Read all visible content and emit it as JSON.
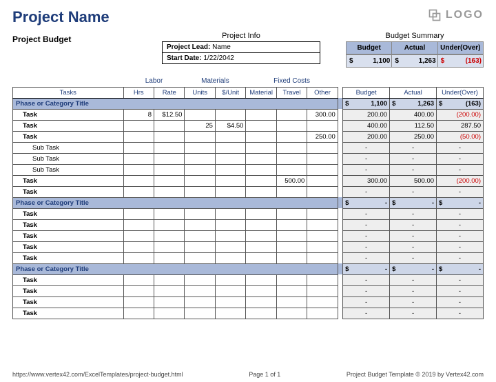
{
  "title": "Project Name",
  "subtitle": "Project Budget",
  "logo_text": "LOGO",
  "project_info": {
    "heading": "Project Info",
    "lead_label": "Project Lead:",
    "lead_value": "Name",
    "date_label": "Start Date:",
    "date_value": "1/22/2042"
  },
  "budget_summary": {
    "heading": "Budget Summary",
    "cols": [
      "Budget",
      "Actual",
      "Under(Over)"
    ],
    "vals": [
      "1,100",
      "1,263",
      "(163)"
    ]
  },
  "col_groups": {
    "labor": "Labor",
    "materials": "Materials",
    "fixed": "Fixed Costs"
  },
  "cols": {
    "tasks": "Tasks",
    "hrs": "Hrs",
    "rate": "Rate",
    "units": "Units",
    "unitcost": "$/Unit",
    "material": "Material",
    "travel": "Travel",
    "other": "Other",
    "budget": "Budget",
    "actual": "Actual",
    "underover": "Under(Over)"
  },
  "rows": [
    {
      "type": "phase",
      "label": "Phase or Category Title",
      "budget": "1,100",
      "actual": "1,263",
      "uo": "(163)",
      "uo_neg": true,
      "dollars": true
    },
    {
      "type": "task",
      "label": "Task",
      "hrs": "8",
      "rate": "$12.50",
      "other": "300.00",
      "budget": "200.00",
      "actual": "400.00",
      "uo": "(200.00)",
      "uo_neg": true
    },
    {
      "type": "task",
      "label": "Task",
      "units": "25",
      "unitcost": "$4.50",
      "budget": "400.00",
      "actual": "112.50",
      "uo": "287.50"
    },
    {
      "type": "task",
      "label": "Task",
      "other": "250.00",
      "budget": "200.00",
      "actual": "250.00",
      "uo": "(50.00)",
      "uo_neg": true
    },
    {
      "type": "subtask",
      "label": "Sub Task",
      "budget": "-",
      "actual": "-",
      "uo": "-",
      "center": true
    },
    {
      "type": "subtask",
      "label": "Sub Task",
      "budget": "-",
      "actual": "-",
      "uo": "-",
      "center": true
    },
    {
      "type": "subtask",
      "label": "Sub Task",
      "budget": "-",
      "actual": "-",
      "uo": "-",
      "center": true
    },
    {
      "type": "task",
      "label": "Task",
      "travel": "500.00",
      "budget": "300.00",
      "actual": "500.00",
      "uo": "(200.00)",
      "uo_neg": true
    },
    {
      "type": "task",
      "label": "Task",
      "budget": "-",
      "actual": "-",
      "uo": "-",
      "center": true
    },
    {
      "type": "phase",
      "label": "Phase or Category Title",
      "budget": "-",
      "actual": "-",
      "uo": "-",
      "dollars": true
    },
    {
      "type": "task",
      "label": "Task",
      "budget": "-",
      "actual": "-",
      "uo": "-",
      "center": true
    },
    {
      "type": "task",
      "label": "Task",
      "budget": "-",
      "actual": "-",
      "uo": "-",
      "center": true
    },
    {
      "type": "task",
      "label": "Task",
      "budget": "-",
      "actual": "-",
      "uo": "-",
      "center": true
    },
    {
      "type": "task",
      "label": "Task",
      "budget": "-",
      "actual": "-",
      "uo": "-",
      "center": true
    },
    {
      "type": "task",
      "label": "Task",
      "budget": "-",
      "actual": "-",
      "uo": "-",
      "center": true
    },
    {
      "type": "phase",
      "label": "Phase or Category Title",
      "budget": "-",
      "actual": "-",
      "uo": "-",
      "dollars": true
    },
    {
      "type": "task",
      "label": "Task",
      "budget": "-",
      "actual": "-",
      "uo": "-",
      "center": true
    },
    {
      "type": "task",
      "label": "Task",
      "budget": "-",
      "actual": "-",
      "uo": "-",
      "center": true
    },
    {
      "type": "task",
      "label": "Task",
      "budget": "-",
      "actual": "-",
      "uo": "-",
      "center": true
    },
    {
      "type": "task",
      "label": "Task",
      "budget": "-",
      "actual": "-",
      "uo": "-",
      "center": true
    }
  ],
  "footer": {
    "left": "https://www.vertex42.com/ExcelTemplates/project-budget.html",
    "center": "Page 1 of 1",
    "right": "Project Budget Template © 2019 by Vertex42.com"
  }
}
